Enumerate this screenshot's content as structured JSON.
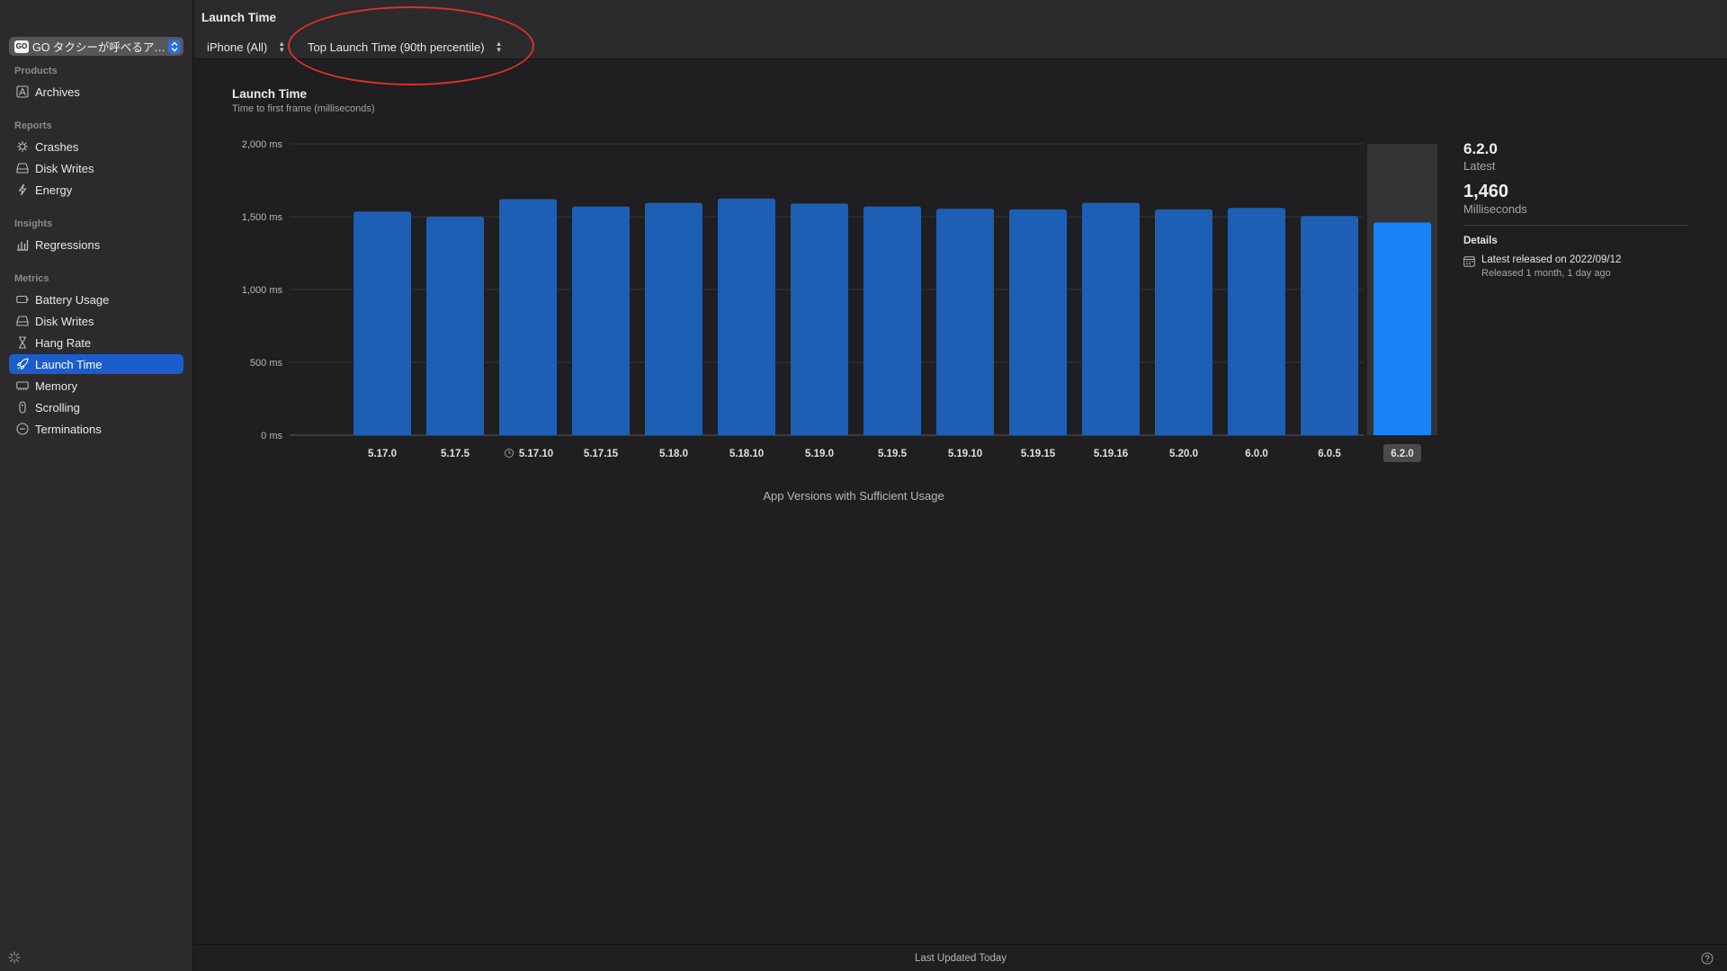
{
  "sidebar": {
    "app_picker": {
      "logo": "GO",
      "label": "GO タクシーが呼べるアプ..."
    },
    "sections": [
      {
        "title": "Products",
        "items": [
          {
            "label": "Archives",
            "icon": "archive-icon"
          }
        ]
      },
      {
        "title": "Reports",
        "items": [
          {
            "label": "Crashes",
            "icon": "crash-icon"
          },
          {
            "label": "Disk Writes",
            "icon": "disk-icon"
          },
          {
            "label": "Energy",
            "icon": "energy-icon"
          }
        ]
      },
      {
        "title": "Insights",
        "items": [
          {
            "label": "Regressions",
            "icon": "regressions-icon"
          }
        ]
      },
      {
        "title": "Metrics",
        "items": [
          {
            "label": "Battery Usage",
            "icon": "battery-icon"
          },
          {
            "label": "Disk Writes",
            "icon": "disk-icon"
          },
          {
            "label": "Hang Rate",
            "icon": "hourglass-icon"
          },
          {
            "label": "Launch Time",
            "icon": "rocket-icon",
            "active": true
          },
          {
            "label": "Memory",
            "icon": "memory-icon"
          },
          {
            "label": "Scrolling",
            "icon": "scrolling-icon"
          },
          {
            "label": "Terminations",
            "icon": "terminations-icon"
          }
        ]
      }
    ]
  },
  "toolbar": {
    "title": "Launch Time",
    "device_popup": "iPhone (All)",
    "metric_popup": "Top Launch Time (90th percentile)"
  },
  "chart_header": {
    "title": "Launch Time",
    "subtitle": "Time to first frame (milliseconds)"
  },
  "chart_data": {
    "type": "bar",
    "categories": [
      "5.17.0",
      "5.17.5",
      "5.17.10",
      "5.17.15",
      "5.18.0",
      "5.18.10",
      "5.19.0",
      "5.19.5",
      "5.19.10",
      "5.19.15",
      "5.19.16",
      "5.20.0",
      "6.0.0",
      "6.0.5",
      "6.2.0"
    ],
    "values": [
      1535,
      1500,
      1620,
      1570,
      1595,
      1625,
      1590,
      1570,
      1555,
      1550,
      1595,
      1550,
      1560,
      1505,
      1460
    ],
    "ylim": [
      0,
      2000
    ],
    "yticks": [
      {
        "value": 0,
        "label": "0 ms"
      },
      {
        "value": 500,
        "label": "500 ms"
      },
      {
        "value": 1000,
        "label": "1,000 ms"
      },
      {
        "value": 1500,
        "label": "1,500 ms"
      },
      {
        "value": 2000,
        "label": "2,000 ms"
      }
    ],
    "xlabel": "App Versions with Sufficient Usage",
    "selected": "6.2.0",
    "marked_category": "5.17.10",
    "grid": true,
    "colors": {
      "bar": "#1d5fb4",
      "selected_bar": "#1a82f7",
      "selected_band": "#333234"
    }
  },
  "details": {
    "version": "6.2.0",
    "version_caption": "Latest",
    "value": "1,460",
    "value_unit": "Milliseconds",
    "heading": "Details",
    "release_line1": "Latest released on 2022/09/12",
    "release_line2": "Released 1 month, 1 day ago"
  },
  "footer": {
    "text": "Last Updated Today"
  }
}
